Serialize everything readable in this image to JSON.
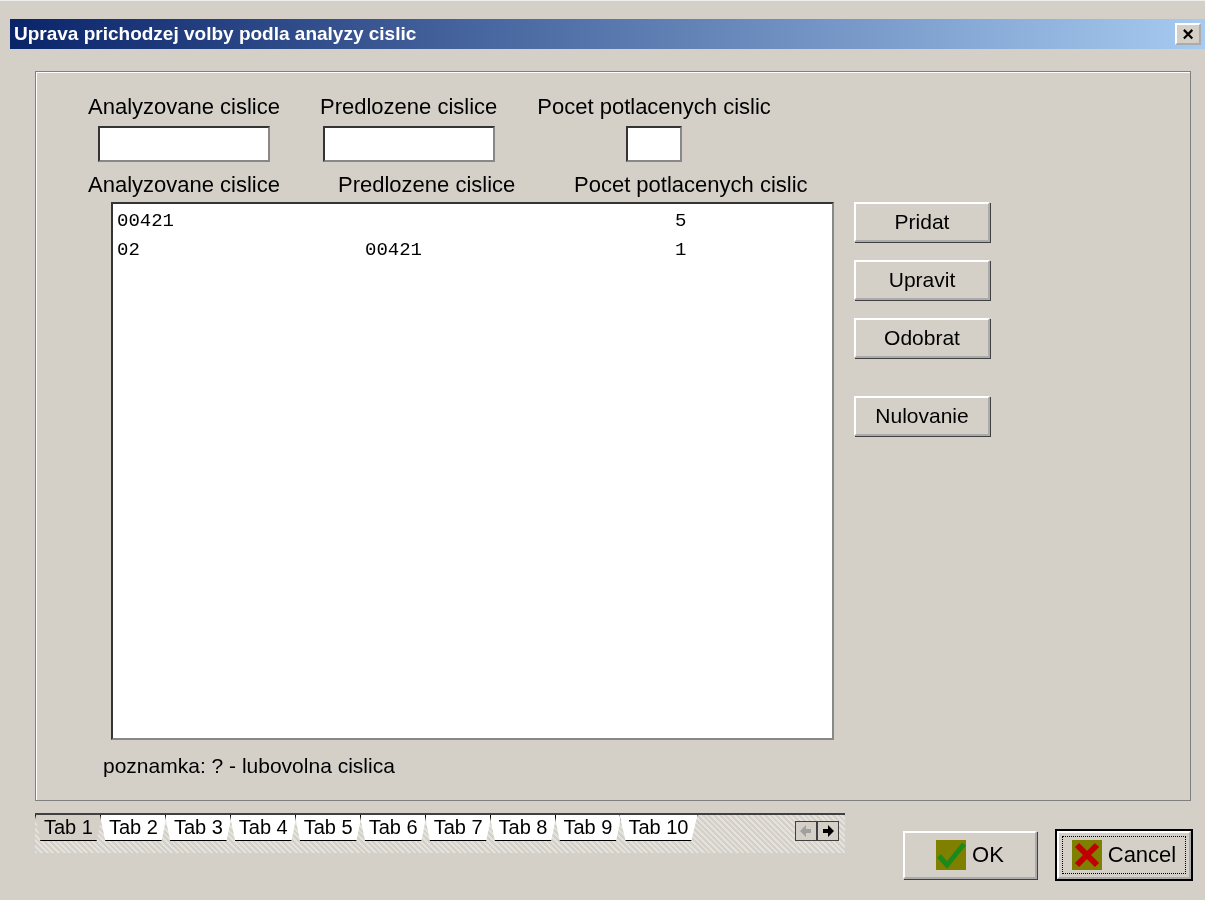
{
  "window": {
    "title": "Uprava prichodzej volby podla analyzy cislic",
    "close": "×"
  },
  "inputs": [
    {
      "label": "Analyzovane cislice"
    },
    {
      "label": "Predlozene cislice"
    },
    {
      "label": "Pocet potlacenych cislic"
    }
  ],
  "list": {
    "columns": [
      "Analyzovane cislice",
      "Predlozene cislice",
      "Pocet potlacenych cislic"
    ],
    "rows": [
      [
        "00421",
        "",
        "5"
      ],
      [
        "02",
        "00421",
        "1"
      ]
    ]
  },
  "side_buttons": [
    {
      "label": "Pridat"
    },
    {
      "label": "Upravit"
    },
    {
      "label": "Odobrat"
    },
    {
      "label": "Nulovanie"
    }
  ],
  "note": "poznamka:  ? - lubovolna cislica",
  "tabs": [
    {
      "label": "Tab 1",
      "selected": true
    },
    {
      "label": "Tab 2",
      "selected": false
    },
    {
      "label": "Tab 3",
      "selected": false
    },
    {
      "label": "Tab 4",
      "selected": false
    },
    {
      "label": "Tab 5",
      "selected": false
    },
    {
      "label": "Tab 6",
      "selected": false
    },
    {
      "label": "Tab 7",
      "selected": false
    },
    {
      "label": "Tab 8",
      "selected": false
    },
    {
      "label": "Tab 9",
      "selected": false
    },
    {
      "label": "Tab 10",
      "selected": false
    }
  ],
  "dialog_buttons": [
    {
      "label": "OK",
      "kind": "ok",
      "focused": false
    },
    {
      "label": "Cancel",
      "kind": "cancel",
      "focused": true
    }
  ]
}
